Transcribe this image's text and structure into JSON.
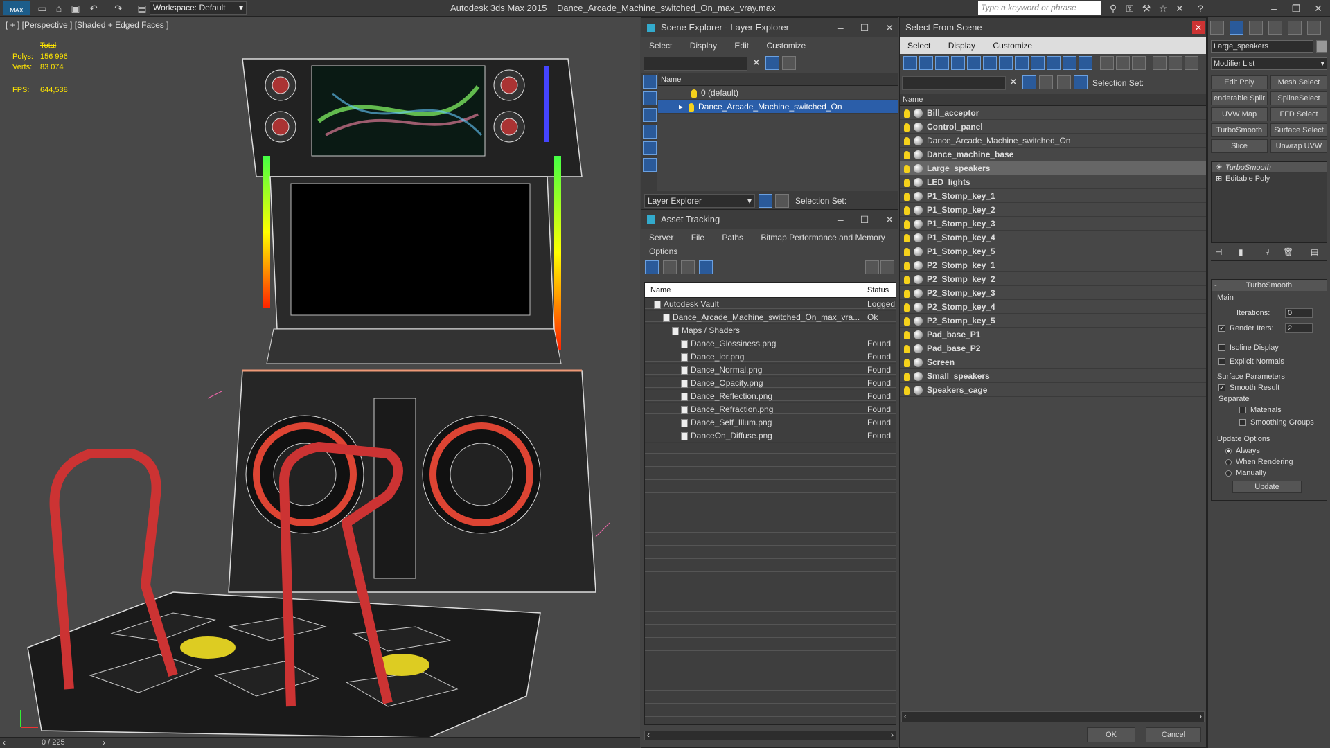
{
  "app": {
    "logo": "MAX",
    "workspace": "Workspace: Default",
    "title": "Autodesk 3ds Max  2015",
    "filename": "Dance_Arcade_Machine_switched_On_max_vray.max",
    "search_placeholder": "Type a keyword or phrase"
  },
  "viewport": {
    "label": "[ + ] [Perspective ] [Shaded + Edged Faces ]",
    "stats": {
      "total_label": "Total",
      "polys_label": "Polys:",
      "polys": "156 996",
      "verts_label": "Verts:",
      "verts": "83 074",
      "fps_label": "FPS:",
      "fps": "644,538"
    },
    "frame_counter": "0 / 225"
  },
  "scene_explorer": {
    "title": "Scene Explorer - Layer Explorer",
    "menu": [
      "Select",
      "Display",
      "Edit",
      "Customize"
    ],
    "column": "Name",
    "layers": [
      "0 (default)",
      "Dance_Arcade_Machine_switched_On"
    ],
    "footer_dropdown": "Layer Explorer",
    "selection_set": "Selection Set:"
  },
  "asset_tracking": {
    "title": "Asset Tracking",
    "menu": [
      "Server",
      "File",
      "Paths",
      "Bitmap Performance and Memory"
    ],
    "menu2": "Options",
    "columns": [
      "Name",
      "Status"
    ],
    "rows": [
      {
        "name": "Autodesk Vault",
        "status": "Logged",
        "indent": 1
      },
      {
        "name": "Dance_Arcade_Machine_switched_On_max_vra...",
        "status": "Ok",
        "indent": 2
      },
      {
        "name": "Maps / Shaders",
        "status": "",
        "indent": 3
      },
      {
        "name": "Dance_Glossiness.png",
        "status": "Found",
        "indent": 4
      },
      {
        "name": "Dance_ior.png",
        "status": "Found",
        "indent": 4
      },
      {
        "name": "Dance_Normal.png",
        "status": "Found",
        "indent": 4
      },
      {
        "name": "Dance_Opacity.png",
        "status": "Found",
        "indent": 4
      },
      {
        "name": "Dance_Reflection.png",
        "status": "Found",
        "indent": 4
      },
      {
        "name": "Dance_Refraction.png",
        "status": "Found",
        "indent": 4
      },
      {
        "name": "Dance_Self_Illum.png",
        "status": "Found",
        "indent": 4
      },
      {
        "name": "DanceOn_Diffuse.png",
        "status": "Found",
        "indent": 4
      }
    ]
  },
  "select_from_scene": {
    "title": "Select From Scene",
    "menu": [
      "Select",
      "Display",
      "Customize"
    ],
    "selection_set": "Selection Set:",
    "column": "Name",
    "objects": [
      "Bill_acceptor",
      "Control_panel",
      "Dance_Arcade_Machine_switched_On",
      "Dance_machine_base",
      "Large_speakers",
      "LED_lights",
      "P1_Stomp_key_1",
      "P1_Stomp_key_2",
      "P1_Stomp_key_3",
      "P1_Stomp_key_4",
      "P1_Stomp_key_5",
      "P2_Stomp_key_1",
      "P2_Stomp_key_2",
      "P2_Stomp_key_3",
      "P2_Stomp_key_4",
      "P2_Stomp_key_5",
      "Pad_base_P1",
      "Pad_base_P2",
      "Screen",
      "Small_speakers",
      "Speakers_cage"
    ],
    "ok": "OK",
    "cancel": "Cancel"
  },
  "modify_panel": {
    "object_name": "Large_speakers",
    "modifier_list": "Modifier List",
    "buttons": [
      "Edit Poly",
      "Mesh Select",
      "enderable Splir",
      "SplineSelect",
      "UVW Map",
      "FFD Select",
      "TurboSmooth",
      "Surface Select",
      "Slice",
      "Unwrap UVW"
    ],
    "stack": [
      "TurboSmooth",
      "Editable Poly"
    ],
    "rollout": {
      "title": "TurboSmooth",
      "main": "Main",
      "iterations_label": "Iterations:",
      "iterations": "0",
      "render_iters_label": "Render Iters:",
      "render_iters": "2",
      "isoline": "Isoline Display",
      "explicit": "Explicit Normals",
      "surface_params": "Surface Parameters",
      "smooth_result": "Smooth Result",
      "separate": "Separate",
      "materials": "Materials",
      "smoothing_groups": "Smoothing Groups",
      "update_options": "Update Options",
      "always": "Always",
      "when_rendering": "When Rendering",
      "manually": "Manually",
      "update": "Update"
    }
  }
}
